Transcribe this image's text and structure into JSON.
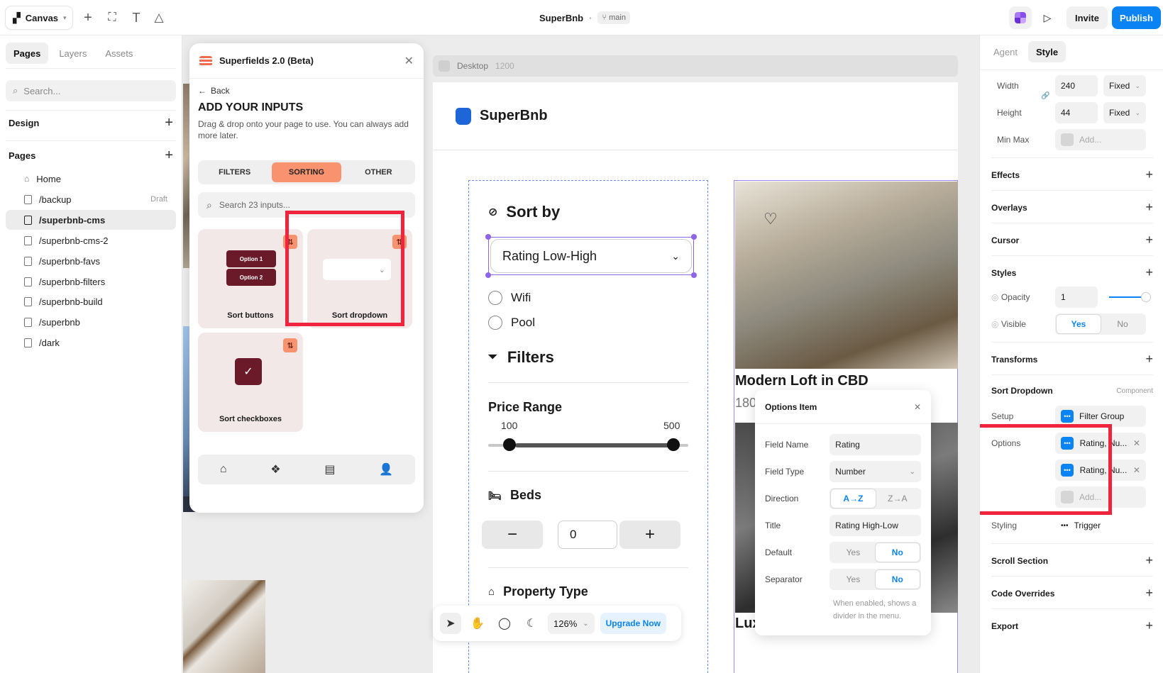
{
  "topbar": {
    "app_menu": "Canvas",
    "project": "SuperBnb",
    "branch": "main",
    "invite": "Invite",
    "publish": "Publish"
  },
  "left": {
    "tabs": [
      "Pages",
      "Layers",
      "Assets"
    ],
    "search_placeholder": "Search...",
    "design_label": "Design",
    "pages_label": "Pages",
    "pages": [
      {
        "name": "Home",
        "tag": ""
      },
      {
        "name": "/backup",
        "tag": "Draft"
      },
      {
        "name": "/superbnb-cms",
        "tag": ""
      },
      {
        "name": "/superbnb-cms-2",
        "tag": ""
      },
      {
        "name": "/superbnb-favs",
        "tag": ""
      },
      {
        "name": "/superbnb-filters",
        "tag": ""
      },
      {
        "name": "/superbnb-build",
        "tag": ""
      },
      {
        "name": "/superbnb",
        "tag": ""
      },
      {
        "name": "/dark",
        "tag": ""
      }
    ]
  },
  "superfields": {
    "title": "Superfields 2.0 (Beta)",
    "back": "Back",
    "heading": "ADD YOUR INPUTS",
    "subtitle": "Drag & drop onto your page to use. You can always add more later.",
    "tabs": [
      "FILTERS",
      "SORTING",
      "OTHER"
    ],
    "search_placeholder": "Search 23 inputs...",
    "cards": {
      "sort_buttons": "Sort buttons",
      "option1": "Option 1",
      "option2": "Option 2",
      "sort_dropdown": "Sort dropdown",
      "sort_checkboxes": "Sort checkboxes"
    }
  },
  "canvas": {
    "breakpoint": "Desktop",
    "breakpoint_width": "1200",
    "brand": "SuperBnb",
    "sort_by": "Sort by",
    "dropdown_value": "Rating Low-High",
    "options": [
      "Wifi",
      "Pool"
    ],
    "filters": "Filters",
    "price_range": "Price Range",
    "price_min": "100",
    "price_max": "500",
    "beds": "Beds",
    "beds_value": "0",
    "property_type": "Property Type",
    "listing1_title": "Modern Loft in CBD",
    "listing1_sub": "180",
    "listing2_title": "Lux"
  },
  "options_popup": {
    "title": "Options Item",
    "field_name_label": "Field Name",
    "field_name": "Rating",
    "field_type_label": "Field Type",
    "field_type": "Number",
    "direction_label": "Direction",
    "dir_a": "A→Z",
    "dir_b": "Z→A",
    "title_label": "Title",
    "title_value": "Rating High-Low",
    "default_label": "Default",
    "separator_label": "Separator",
    "yes": "Yes",
    "no": "No",
    "note": "When enabled, shows a divider in the menu."
  },
  "toolbar": {
    "zoom": "126%",
    "upgrade": "Upgrade Now"
  },
  "right": {
    "tabs": [
      "Agent",
      "Style"
    ],
    "width_label": "Width",
    "width": "240",
    "height_label": "Height",
    "height": "44",
    "fixed": "Fixed",
    "minmax_label": "Min Max",
    "add": "Add...",
    "effects": "Effects",
    "overlays": "Overlays",
    "cursor": "Cursor",
    "styles": "Styles",
    "opacity_label": "Opacity",
    "opacity": "1",
    "visible_label": "Visible",
    "yes": "Yes",
    "no": "No",
    "transforms": "Transforms",
    "component_name": "Sort Dropdown",
    "component_tag": "Component",
    "setup_label": "Setup",
    "setup_value": "Filter Group",
    "options_label": "Options",
    "option_item": "Rating, Nu...",
    "styling_label": "Styling",
    "styling_value": "Trigger",
    "scroll_section": "Scroll Section",
    "code_overrides": "Code Overrides",
    "export": "Export"
  },
  "colors": {
    "accent": "#0a84f5",
    "highlight": "#f0243c",
    "sorting_tab": "#f9936f",
    "selection": "#8e65e8"
  }
}
